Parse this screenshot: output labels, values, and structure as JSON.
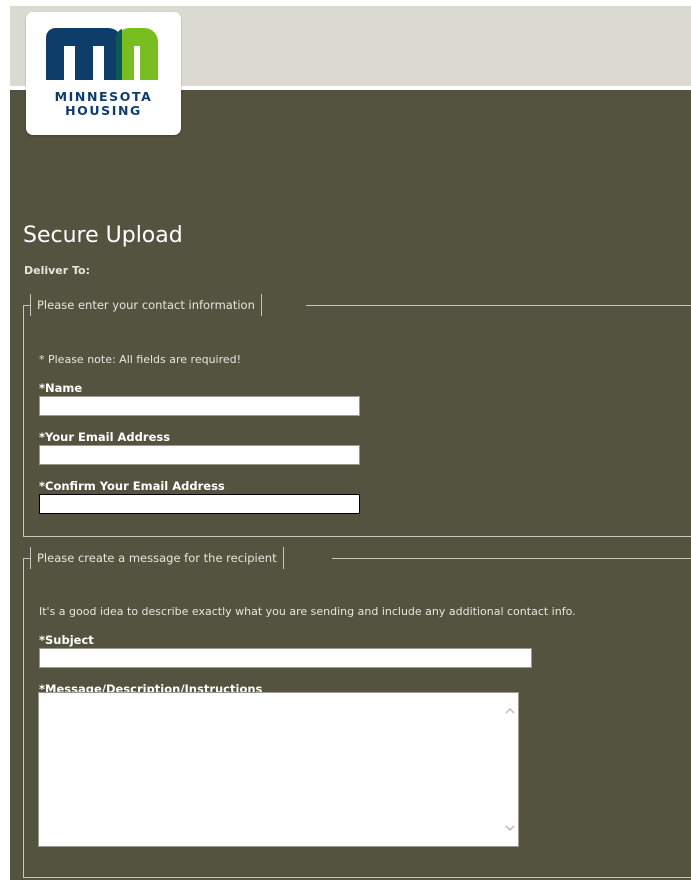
{
  "brand": {
    "logo_letters": "mn",
    "logo_line1": "MINNESOTA",
    "logo_line2": "HOUSING",
    "colors": {
      "navy": "#0f3d6a",
      "green": "#78be20",
      "page_bg": "#54533f",
      "top_band": "#dcdbd3"
    }
  },
  "page": {
    "title": "Secure Upload",
    "deliver_to_label": "Deliver To:"
  },
  "contact_section": {
    "legend": "Please enter your contact information",
    "note": "* Please note: All fields are required!",
    "fields": {
      "name": {
        "label": "*Name",
        "value": ""
      },
      "email": {
        "label": "*Your Email Address",
        "value": ""
      },
      "confirm_email": {
        "label": "*Confirm Your Email Address",
        "value": ""
      }
    }
  },
  "message_section": {
    "legend": "Please create a message for the recipient",
    "note": "It's a good idea to describe exactly what you are sending and include any additional contact info.",
    "fields": {
      "subject": {
        "label": "*Subject",
        "value": ""
      },
      "message": {
        "label": "*Message/Description/Instructions",
        "value": ""
      }
    },
    "scrollbar_icons": {
      "up": "chevron-up-icon",
      "down": "chevron-down-icon"
    }
  }
}
